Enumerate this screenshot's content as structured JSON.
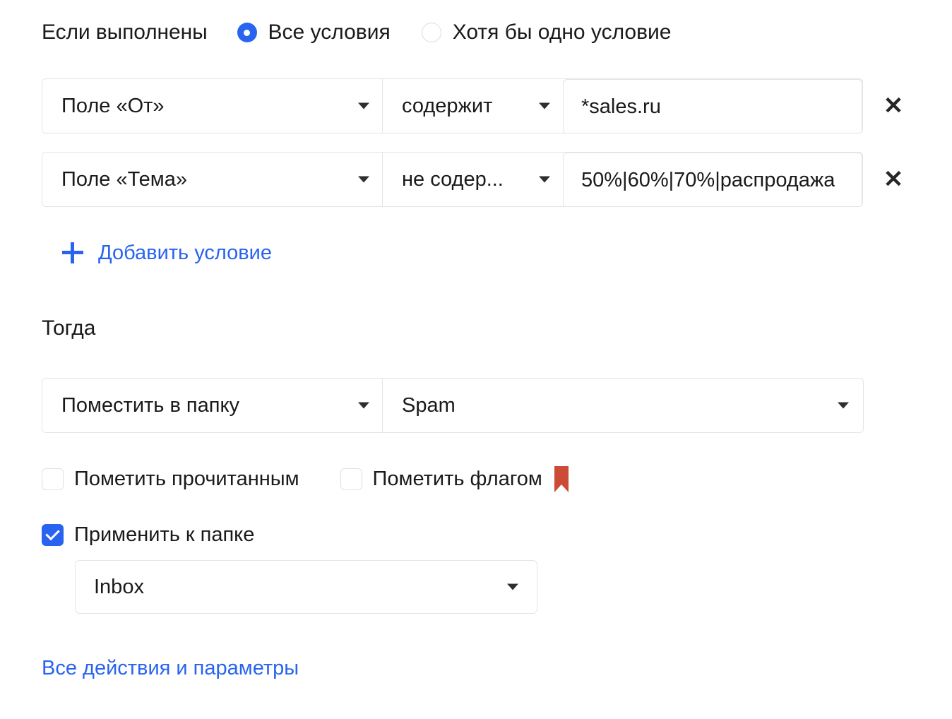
{
  "conditions_section": {
    "if_label": "Если выполнены",
    "match_mode": {
      "options": [
        {
          "label": "Все условия",
          "selected": true
        },
        {
          "label": "Хотя бы одно условие",
          "selected": false
        }
      ]
    },
    "rows": [
      {
        "field": "Поле «От»",
        "operator": "содержит",
        "value": "*sales.ru",
        "remove_label": "✕"
      },
      {
        "field": "Поле «Тема»",
        "operator": "не содер...",
        "value": "50%|60%|70%|распродажа",
        "remove_label": "✕"
      }
    ],
    "add_condition_label": "Добавить условие",
    "add_condition_icon": "plus-icon"
  },
  "actions_section": {
    "then_label": "Тогда",
    "action": "Поместить в папку",
    "target_folder": "Spam",
    "checkboxes": [
      {
        "label": "Пометить прочитанным",
        "checked": false
      },
      {
        "label": "Пометить флагом",
        "checked": false,
        "icon": "flag-icon"
      }
    ],
    "apply_to_folder": {
      "label": "Применить к папке",
      "checked": true
    },
    "apply_folder_value": "Inbox",
    "all_actions_link": "Все действия и параметры"
  },
  "colors": {
    "accent_blue": "#2864f0",
    "flag_red": "#cc4b37",
    "border_gray": "#e4e4e4",
    "text_dark": "#1a1a1a"
  }
}
